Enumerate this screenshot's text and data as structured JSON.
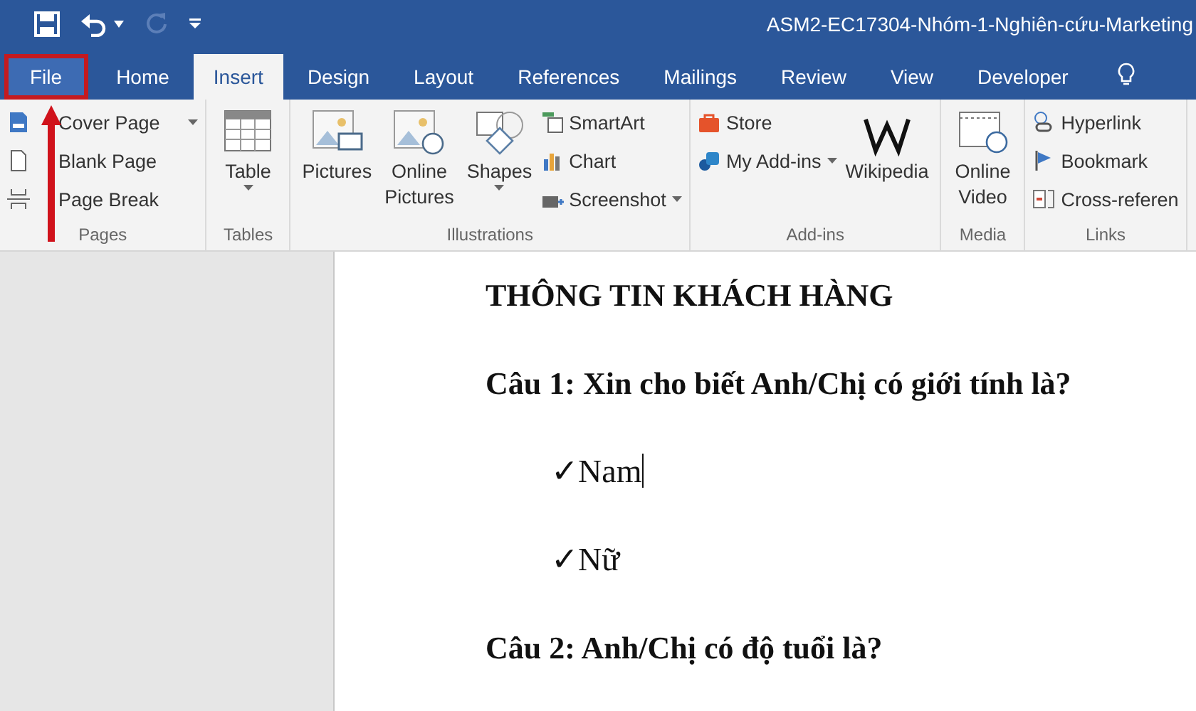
{
  "title_bar": {
    "title": "ASM2-EC17304-Nhóm-1-Nghiên-cứu-Marketing",
    "redo_disabled": true
  },
  "tabs": [
    {
      "label": "File",
      "kind": "file",
      "selected": false,
      "highlighted": true
    },
    {
      "label": "Home",
      "kind": "tab",
      "selected": false,
      "highlighted": false
    },
    {
      "label": "Insert",
      "kind": "tab",
      "selected": true,
      "highlighted": false
    },
    {
      "label": "Design",
      "kind": "tab",
      "selected": false,
      "highlighted": false
    },
    {
      "label": "Layout",
      "kind": "tab",
      "selected": false,
      "highlighted": false
    },
    {
      "label": "References",
      "kind": "tab",
      "selected": false,
      "highlighted": false
    },
    {
      "label": "Mailings",
      "kind": "tab",
      "selected": false,
      "highlighted": false
    },
    {
      "label": "Review",
      "kind": "tab",
      "selected": false,
      "highlighted": false
    },
    {
      "label": "View",
      "kind": "tab",
      "selected": false,
      "highlighted": false
    },
    {
      "label": "Developer",
      "kind": "tab",
      "selected": false,
      "highlighted": false
    }
  ],
  "ribbon": [
    {
      "label": "Pages",
      "items": [
        {
          "label": "Cover Page",
          "kind": "small",
          "dropdown": true
        },
        {
          "label": "Blank Page",
          "kind": "small",
          "dropdown": false
        },
        {
          "label": "Page Break",
          "kind": "small",
          "dropdown": false
        }
      ]
    },
    {
      "label": "Tables",
      "items": [
        {
          "label": "Table",
          "kind": "large",
          "dropdown": true
        }
      ]
    },
    {
      "label": "Illustrations",
      "items": [
        {
          "label": "Pictures",
          "kind": "large",
          "dropdown": false
        },
        {
          "label": "Online Pictures",
          "kind": "large",
          "dropdown": false
        },
        {
          "label": "Shapes",
          "kind": "large",
          "dropdown": true
        },
        {
          "label": "SmartArt",
          "kind": "small",
          "dropdown": false
        },
        {
          "label": "Chart",
          "kind": "small",
          "dropdown": false
        },
        {
          "label": "Screenshot",
          "kind": "small",
          "dropdown": true
        }
      ]
    },
    {
      "label": "Add-ins",
      "items": [
        {
          "label": "Store",
          "kind": "small",
          "dropdown": false
        },
        {
          "label": "My Add-ins",
          "kind": "small",
          "dropdown": true
        },
        {
          "label": "Wikipedia",
          "kind": "large",
          "dropdown": false
        }
      ]
    },
    {
      "label": "Media",
      "items": [
        {
          "label": "Online Video",
          "kind": "large",
          "dropdown": false
        }
      ]
    },
    {
      "label": "Links",
      "items": [
        {
          "label": "Hyperlink",
          "kind": "small",
          "dropdown": false
        },
        {
          "label": "Bookmark",
          "kind": "small",
          "dropdown": false
        },
        {
          "label": "Cross-referen",
          "kind": "small",
          "dropdown": false
        }
      ]
    }
  ],
  "document": {
    "paragraphs": [
      {
        "kind": "heading",
        "text": "THÔNG TIN KHÁCH HÀNG",
        "cursor": false
      },
      {
        "kind": "question",
        "text": "Câu 1: Xin cho biết Anh/Chị có giới tính là?",
        "cursor": false
      },
      {
        "kind": "option",
        "text": "✓Nam",
        "cursor": true
      },
      {
        "kind": "option",
        "text": "✓Nữ",
        "cursor": false
      },
      {
        "kind": "question",
        "text": "Câu 2: Anh/Chị có độ tuổi là?",
        "cursor": false
      }
    ]
  }
}
